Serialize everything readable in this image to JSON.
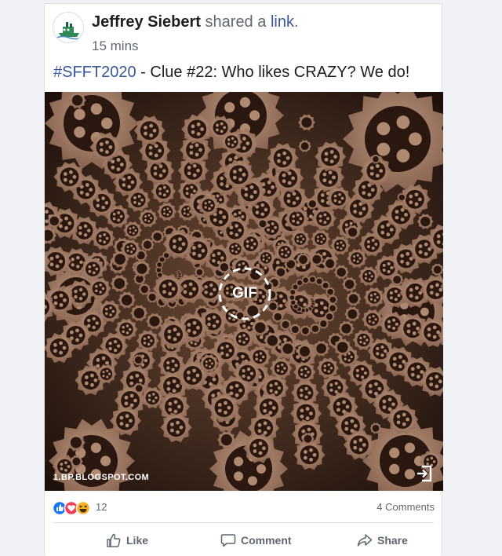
{
  "post": {
    "author": "Jeffrey Siebert",
    "shared_text": "shared a",
    "link_word": "link",
    "period": ".",
    "time": "15 mins",
    "hashtag": "#SFFT2020",
    "message": " - Clue #22: Who likes CRAZY? We do!"
  },
  "media": {
    "badge": "GIF",
    "domain": "1.BP.BLOGSPOT.COM"
  },
  "reactions": {
    "count": "12",
    "comments": "4 Comments"
  },
  "actions": {
    "like": "Like",
    "comment": "Comment",
    "share": "Share"
  },
  "icons": {
    "like": "thumbs-up-icon",
    "love": "heart-icon",
    "haha": "laughing-face-icon",
    "comment": "speech-bubble-icon",
    "share": "share-arrow-icon",
    "link_out": "external-link-icon"
  },
  "colors": {
    "link": "#385898",
    "like_blue": "#1877f2",
    "love_red": "#f33e58",
    "haha_yellow": "#f7b125",
    "muted": "#606770"
  }
}
